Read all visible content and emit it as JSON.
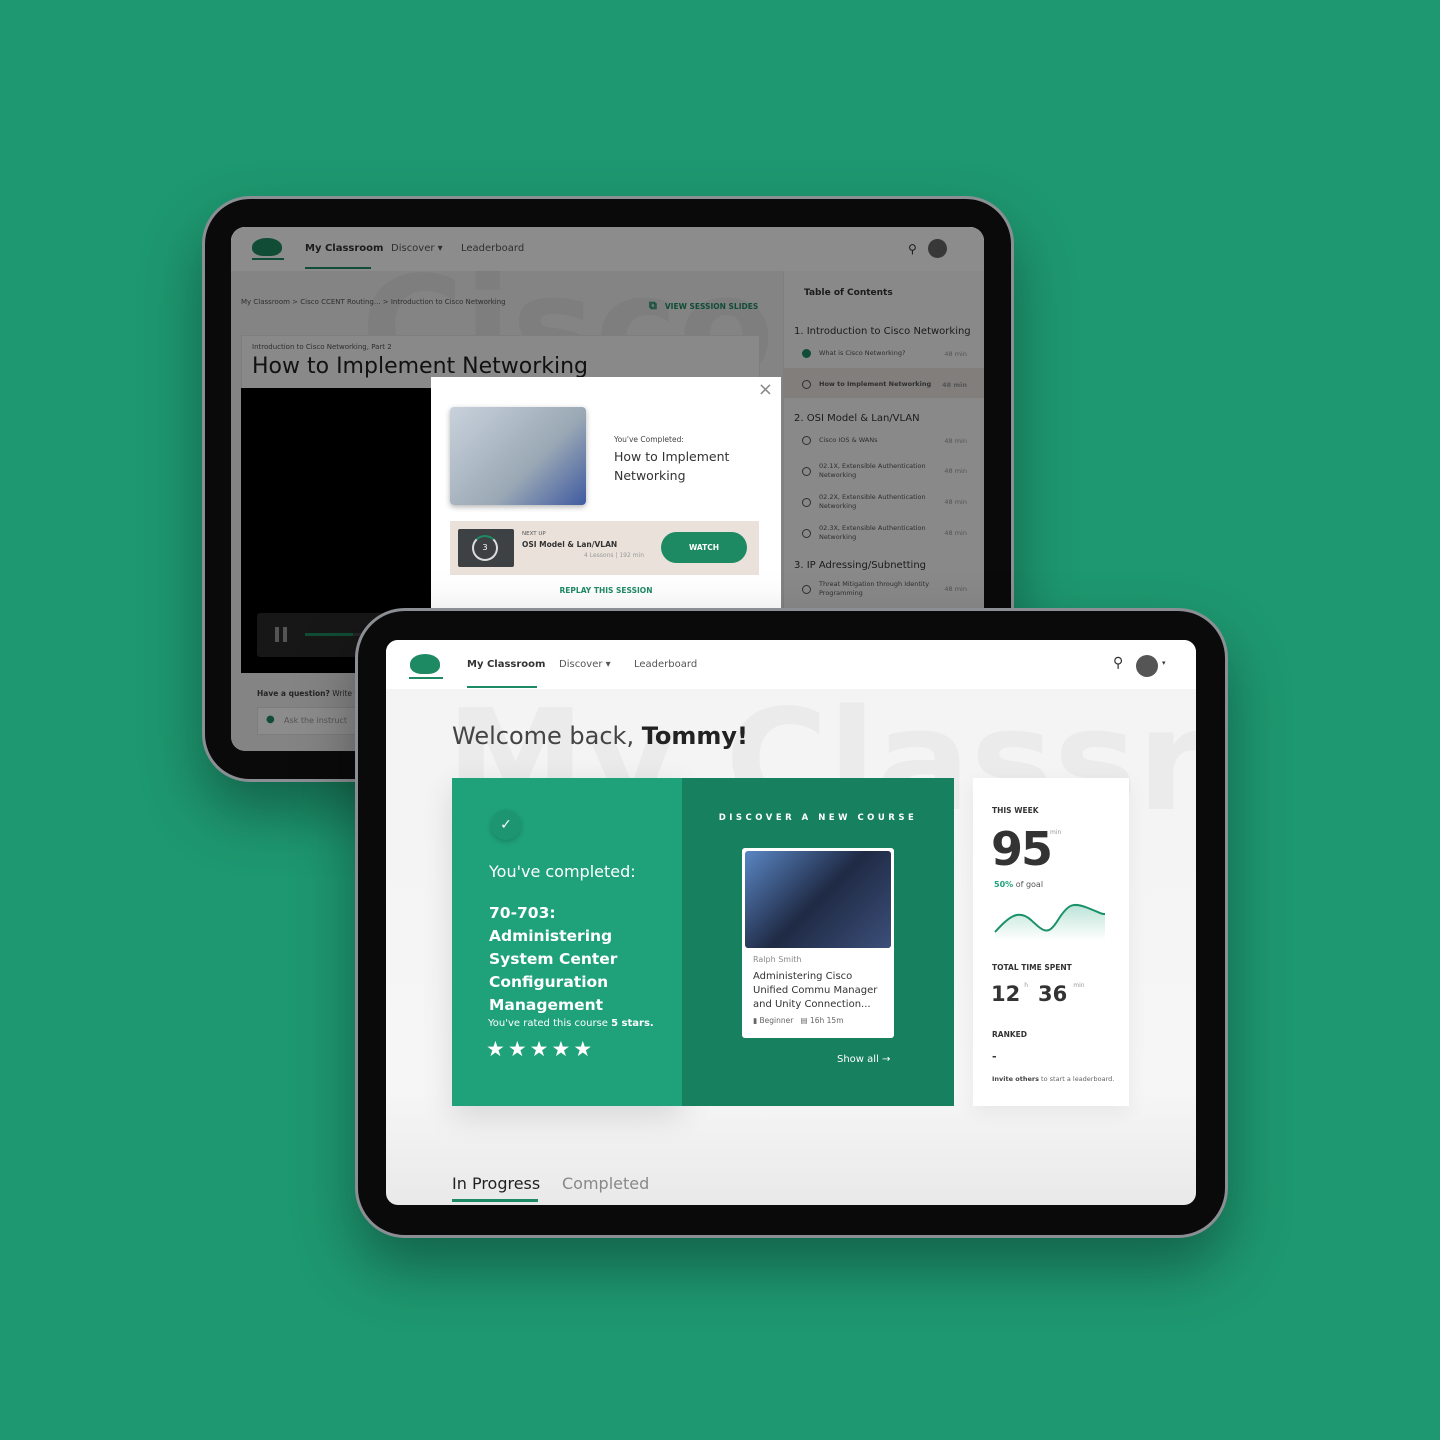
{
  "colors": {
    "background": "#1e9870",
    "accent": "#1e8a63",
    "card_left": "#1fa27a",
    "card_right": "#17805e"
  },
  "back_screen": {
    "nav": {
      "items": [
        {
          "label": "My Classroom",
          "active": true
        },
        {
          "label": "Discover"
        },
        {
          "label": "Leaderboard"
        }
      ]
    },
    "breadcrumb": "My Classroom > Cisco CCENT Routing... > Introduction to Cisco Networking",
    "view_slides": "VIEW SESSION SLIDES",
    "session_subtitle": "Introduction to Cisco Networking, Part 2",
    "session_title": "How to Implement Networking",
    "watermark": "Cisco",
    "question_label": "Have a question?",
    "question_rest": "Write y",
    "ask_placeholder": "Ask the instruct",
    "video_progress_pct": 20,
    "toc": {
      "title": "Table of Contents",
      "sections": [
        {
          "title": "1. Introduction to Cisco Networking",
          "items": [
            {
              "label": "What is Cisco Networking?",
              "duration": "48 min",
              "status": "done"
            },
            {
              "label": "How to Implement Networking",
              "duration": "48 min",
              "status": "current"
            }
          ]
        },
        {
          "title": "2. OSI Model & Lan/VLAN",
          "items": [
            {
              "label": "Cisco IOS & WANs",
              "duration": "48 min",
              "status": "todo"
            },
            {
              "label": "02.1X, Extensible Authentication Networking",
              "duration": "48 min",
              "status": "todo"
            },
            {
              "label": "02.2X, Extensible Authentication Networking",
              "duration": "48 min",
              "status": "todo"
            },
            {
              "label": "02.3X, Extensible Authentication Networking",
              "duration": "48 min",
              "status": "todo"
            }
          ]
        },
        {
          "title": "3. IP Adressing/Subnetting",
          "items": [
            {
              "label": "Threat Mitigation through Identity Programming",
              "duration": "48 min",
              "status": "todo"
            }
          ]
        }
      ]
    },
    "modal": {
      "completed_label": "You've Completed:",
      "completed_title": "How to Implement Networking",
      "next_up_label": "NEXT UP",
      "next_title": "OSI Model & Lan/VLAN",
      "next_meta": "4 Lessons | 192 min",
      "countdown": "3",
      "watch": "WATCH",
      "replay": "REPLAY THIS SESSION"
    }
  },
  "front_screen": {
    "nav": {
      "items": [
        {
          "label": "My Classroom",
          "active": true
        },
        {
          "label": "Discover"
        },
        {
          "label": "Leaderboard"
        }
      ]
    },
    "watermark": "My Classr",
    "welcome": "Welcome back, ",
    "user": "Tommy!",
    "completed": {
      "label": "You've completed:",
      "course": "70-703: Administering System Center Configuration Management",
      "rated_prefix": "You've rated this course ",
      "rated_value": "5 stars.",
      "stars": 5
    },
    "discover": {
      "heading": "DISCOVER A NEW COURSE",
      "author": "Ralph Smith",
      "title": "Administering Cisco Unified Commu Manager and Unity Connection...",
      "level": "Beginner",
      "duration": "16h 15m",
      "show_all": "Show all"
    },
    "stats": {
      "this_week_label": "THIS WEEK",
      "this_week_value": "95",
      "this_week_unit": "min",
      "goal_pct": "50%",
      "goal_text": " of goal",
      "total_label": "TOTAL TIME SPENT",
      "total_hours": "12",
      "hours_unit": "h",
      "total_minutes": "36",
      "minutes_unit": "min",
      "ranked_label": "RANKED",
      "ranked_value": "-",
      "invite_bold": "Invite others",
      "invite_rest": " to start a leaderboard."
    },
    "tabs": [
      {
        "label": "In Progress",
        "active": true
      },
      {
        "label": "Completed"
      }
    ]
  }
}
